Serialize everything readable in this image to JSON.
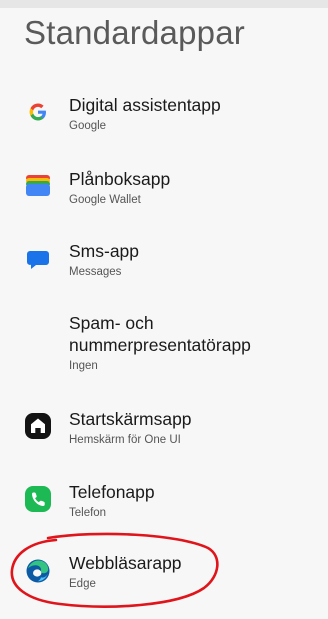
{
  "header": {
    "title": "Standardappar"
  },
  "items": [
    {
      "title": "Digital assistentapp",
      "subtitle": "Google",
      "icon": "google-g-icon"
    },
    {
      "title": "Plånboksapp",
      "subtitle": "Google Wallet",
      "icon": "google-wallet-icon"
    },
    {
      "title": "Sms-app",
      "subtitle": "Messages",
      "icon": "messages-icon"
    },
    {
      "title": "Spam- och nummerpresentatörapp",
      "subtitle": "Ingen",
      "icon": ""
    },
    {
      "title": "Startskärmsapp",
      "subtitle": "Hemskärm för One UI",
      "icon": "home-icon"
    },
    {
      "title": "Telefonapp",
      "subtitle": "Telefon",
      "icon": "phone-icon"
    },
    {
      "title": "Webbläsarapp",
      "subtitle": "Edge",
      "icon": "edge-icon"
    }
  ],
  "annotation": {
    "color": "#e0141b"
  }
}
